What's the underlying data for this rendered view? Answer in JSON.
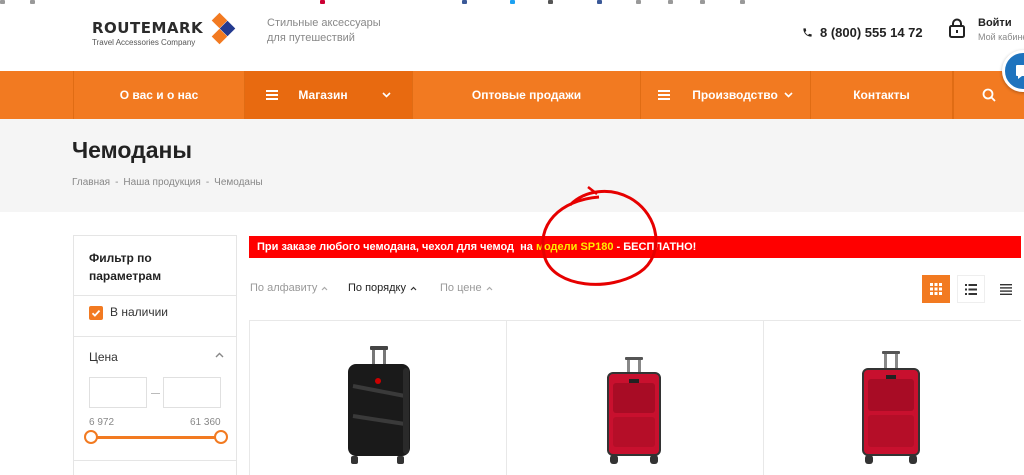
{
  "header": {
    "logo": {
      "name": "ROUTEMARK",
      "sub": "Travel Accessories Company"
    },
    "tagline_line1": "Стильные аксессуары",
    "tagline_line2": "для путешествий",
    "phone": "8 (800) 555 14 72",
    "login_title": "Войти",
    "login_sub": "Мой кабинет"
  },
  "nav": {
    "items": [
      {
        "label": "О вас и о нас"
      },
      {
        "label": "Магазин",
        "icon": "menu-icon",
        "dropdown": true
      },
      {
        "label": "Оптовые продажи"
      },
      {
        "label": "Производство",
        "icon": "menu-icon",
        "dropdown": true
      },
      {
        "label": "Контакты"
      }
    ],
    "search_icon": "search-icon"
  },
  "page": {
    "title": "Чемоданы",
    "breadcrumb": [
      "Главная",
      "Наша продукция",
      "Чемоданы"
    ]
  },
  "filter": {
    "title": "Фильтр по параметрам",
    "in_stock_label": "В наличии",
    "in_stock_checked": true,
    "price_label": "Цена",
    "price_min_placeholder": "",
    "price_max_placeholder": "",
    "price_min": "6 972",
    "price_max": "61 360"
  },
  "promo": {
    "text_start": "При заказе любого чемодана, чехол для чемод",
    "text_gap": "  на ",
    "highlight": "модели SP180",
    "text_end": " - БЕСПЛАТНО!"
  },
  "sort": {
    "options": [
      "По алфавиту",
      "По порядку",
      "По цене"
    ],
    "active": "По порядку"
  },
  "view_modes": [
    "grid-view-icon",
    "list-view-icon",
    "table-view-icon"
  ],
  "products": [
    {
      "color": "#1a1a1a"
    },
    {
      "color": "#c8102e"
    },
    {
      "color": "#c8102e"
    }
  ],
  "colors": {
    "accent": "#f27a21",
    "promo_bg": "#ff0000",
    "promo_highlight": "#ffea00"
  }
}
